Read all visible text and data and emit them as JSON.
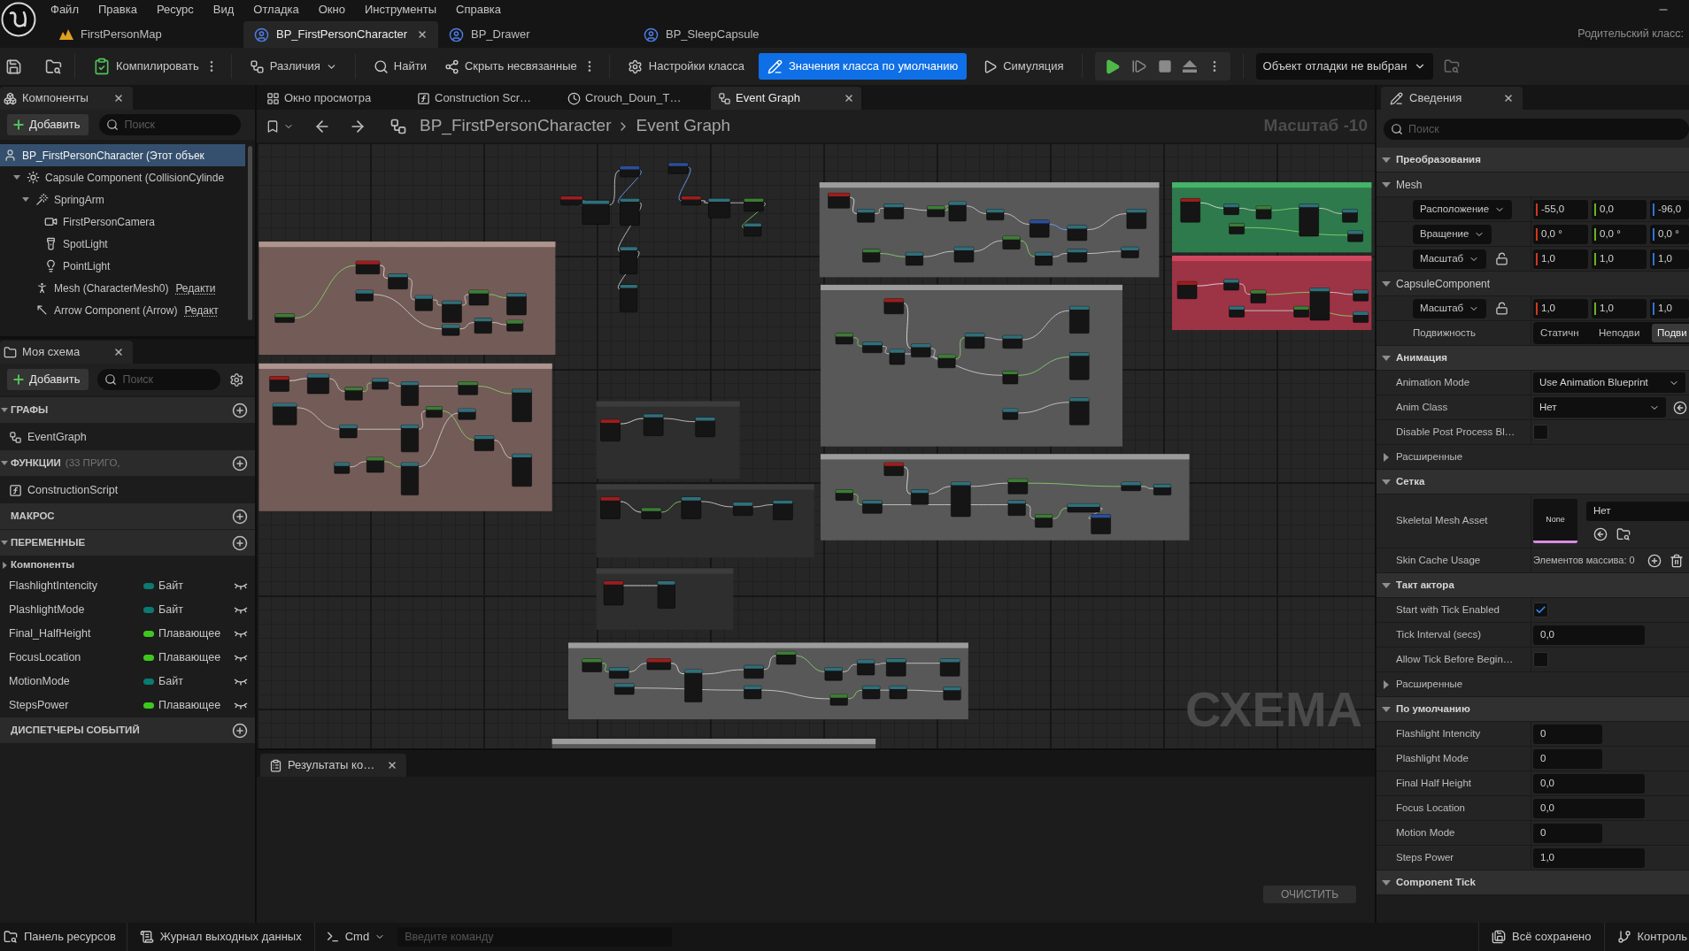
{
  "app": {
    "menu": [
      "Файл",
      "Правка",
      "Ресурс",
      "Вид",
      "Отладка",
      "Окно",
      "Инструменты",
      "Справка"
    ],
    "document_tabs": [
      {
        "label": "FirstPersonMap",
        "kind": "level",
        "selected": false
      },
      {
        "label": "BP_FirstPersonCharacter",
        "kind": "blueprint",
        "selected": true
      },
      {
        "label": "BP_Drawer",
        "kind": "blueprint",
        "selected": false
      },
      {
        "label": "BP_SleepCapsule",
        "kind": "blueprint",
        "selected": false
      }
    ],
    "parent_class": "Родительский класс:"
  },
  "toolbar": {
    "buttons": [
      {
        "label": "Компилировать",
        "kind": "compile"
      },
      {
        "label": "Различия",
        "kind": "diff"
      },
      {
        "label": "Найти",
        "kind": "find"
      },
      {
        "label": "Скрыть несвязанные",
        "kind": "hide"
      }
    ],
    "modes": [
      {
        "label": "Настройки класса",
        "selected": false
      },
      {
        "label": "Значения класса по умолчанию",
        "selected": true
      }
    ],
    "simulate": "Симуляция",
    "debug_object": "Объект отладки не выбран"
  },
  "components": {
    "title": "Компоненты",
    "add_button": "Добавить",
    "search_placeholder": "Поиск",
    "tree": [
      {
        "label": "BP_FirstPersonCharacter (Этот объек",
        "kind": "self",
        "selected": true,
        "children": [
          {
            "label": "Capsule Component (CollisionCylinde",
            "kind": "capsule",
            "selected": false,
            "expanded": true,
            "children": [
              {
                "label": "SpringArm",
                "kind": "spring_arm",
                "selected": false,
                "expanded": true,
                "children": [
                  {
                    "label": "FirstPersonCamera",
                    "kind": "camera",
                    "selected": false
                  },
                  {
                    "label": "SpotLight",
                    "kind": "spot_light",
                    "selected": false
                  },
                  {
                    "label": "PointLight",
                    "kind": "point_light",
                    "selected": false
                  }
                ]
              },
              {
                "label": "Mesh (CharacterMesh0)",
                "kind": "mesh",
                "selected": false,
                "link": "Редакти"
              },
              {
                "label": "Arrow Component (Arrow)",
                "kind": "arrow",
                "selected": false,
                "link": "Редакт"
              }
            ]
          }
        ]
      }
    ]
  },
  "my_blueprint": {
    "title": "Моя схема",
    "add_button": "Добавить",
    "search_placeholder": "Поиск",
    "sections": [
      {
        "title": "ГРАФЫ",
        "items": [
          {
            "label": "EventGraph",
            "kind": "graph"
          }
        ]
      },
      {
        "title": "ФУНКЦИИ",
        "note": "(33 ПРИГО,",
        "items": [
          {
            "label": "ConstructionScript",
            "kind": "function"
          }
        ]
      },
      {
        "title": "МАКРОС"
      },
      {
        "title": "ПЕРЕМЕННЫЕ",
        "categories": [
          {
            "label": "Компоненты",
            "expanded": false
          }
        ],
        "variables": [
          {
            "label": "FlashlightIntencity",
            "type": "Байт",
            "color": "#0b7a72"
          },
          {
            "label": "PlashlightMode",
            "type": "Байт",
            "color": "#0b7a72"
          },
          {
            "label": "Final_HalfHeight",
            "type": "Плавающее",
            "color": "#3ec81e"
          },
          {
            "label": "FocusLocation",
            "type": "Плавающее",
            "color": "#3ec81e"
          },
          {
            "label": "MotionMode",
            "type": "Байт",
            "color": "#0b7a72"
          },
          {
            "label": "StepsPower",
            "type": "Плавающее",
            "color": "#3ec81e"
          }
        ]
      },
      {
        "title": "ДИСПЕТЧЕРЫ СОБЫТИЙ"
      }
    ]
  },
  "editor": {
    "tabs": [
      {
        "label": "Окно просмотра",
        "kind": "viewport",
        "selected": false
      },
      {
        "label": "Construction Scr…",
        "kind": "function",
        "selected": false
      },
      {
        "label": "Crouch_Doun_T…",
        "kind": "timeline",
        "selected": false
      },
      {
        "label": "Event Graph",
        "kind": "graph",
        "selected": true
      }
    ],
    "breadcrumb": [
      "BP_FirstPersonCharacter",
      "Event Graph"
    ],
    "zoom": "Масштаб -10",
    "graph_label": "СХЕМА"
  },
  "compiler_results": {
    "tab": "Результаты ко…",
    "clear_button": "ОЧИСТИТЬ"
  },
  "details": {
    "title": "Сведения",
    "search_placeholder": "Поиск",
    "sections": [
      {
        "title": "Преобразования",
        "expanded": true,
        "groups": [
          {
            "title": "Mesh",
            "expanded": true,
            "rows": [
              {
                "kind": "vector",
                "label": "Расположение",
                "values": [
                  "-55,0",
                  "0,0",
                  "-96,0"
                ]
              },
              {
                "kind": "vector",
                "label": "Вращение",
                "values": [
                  "0,0 °",
                  "0,0 °",
                  "0,0 °"
                ]
              },
              {
                "kind": "vector",
                "label": "Масштаб",
                "values": [
                  "1,0",
                  "1,0",
                  "1,0"
                ],
                "locked": false
              }
            ]
          },
          {
            "title": "CapsuleComponent",
            "expanded": true,
            "rows": [
              {
                "kind": "vector",
                "label": "Масштаб",
                "values": [
                  "1,0",
                  "1,0",
                  "1,0"
                ],
                "locked": false
              },
              {
                "kind": "segmented",
                "label": "Подвижность",
                "options": [
                  {
                    "label": "Статичн",
                    "selected": false
                  },
                  {
                    "label": "Неподви",
                    "selected": false
                  },
                  {
                    "label": "Подви",
                    "selected": true
                  }
                ]
              }
            ]
          }
        ]
      },
      {
        "title": "Анимация",
        "expanded": true,
        "rows": [
          {
            "kind": "dropdown",
            "label": "Animation Mode",
            "value": "Use Animation Blueprint"
          },
          {
            "kind": "class_picker",
            "label": "Anim Class",
            "value": "Нет"
          },
          {
            "kind": "checkbox",
            "label": "Disable Post Process Bl…",
            "checked": false
          },
          {
            "kind": "subcategory",
            "label": "Расширенные",
            "expanded": false
          }
        ]
      },
      {
        "title": "Сетка",
        "expanded": true,
        "rows": [
          {
            "kind": "asset",
            "label": "Skeletal Mesh Asset",
            "thumbnail": "None",
            "value": "Нет"
          },
          {
            "kind": "array",
            "label": "Skin Cache Usage",
            "value": "Элементов массива: 0"
          }
        ]
      },
      {
        "title": "Такт актора",
        "expanded": true,
        "rows": [
          {
            "kind": "checkbox",
            "label": "Start with Tick Enabled",
            "checked": true
          },
          {
            "kind": "number",
            "label": "Tick Interval (secs)",
            "value": "0,0"
          },
          {
            "kind": "checkbox",
            "label": "Allow Tick Before Begin…",
            "checked": false
          },
          {
            "kind": "subcategory",
            "label": "Расширенные",
            "expanded": false
          }
        ]
      },
      {
        "title": "По умолчанию",
        "expanded": true,
        "rows": [
          {
            "kind": "integer",
            "label": "Flashlight Intencity",
            "value": "0"
          },
          {
            "kind": "integer",
            "label": "Plashlight Mode",
            "value": "0"
          },
          {
            "kind": "number",
            "label": "Final Half Height",
            "value": "0,0"
          },
          {
            "kind": "number",
            "label": "Focus Location",
            "value": "0,0"
          },
          {
            "kind": "integer",
            "label": "Motion Mode",
            "value": "0"
          },
          {
            "kind": "number",
            "label": "Steps Power",
            "value": "1,0"
          }
        ]
      },
      {
        "title": "Component Tick",
        "expanded": true
      }
    ]
  },
  "status_bar": {
    "left": [
      {
        "label": "Панель ресурсов",
        "kind": "content"
      },
      {
        "label": "Журнал выходных данных",
        "kind": "log"
      }
    ],
    "console": {
      "label": "Cmd",
      "placeholder": "Введите команду"
    },
    "right": [
      {
        "label": "Всё сохранено",
        "kind": "saved"
      },
      {
        "label": "Контроль",
        "kind": "source_control"
      }
    ]
  }
}
